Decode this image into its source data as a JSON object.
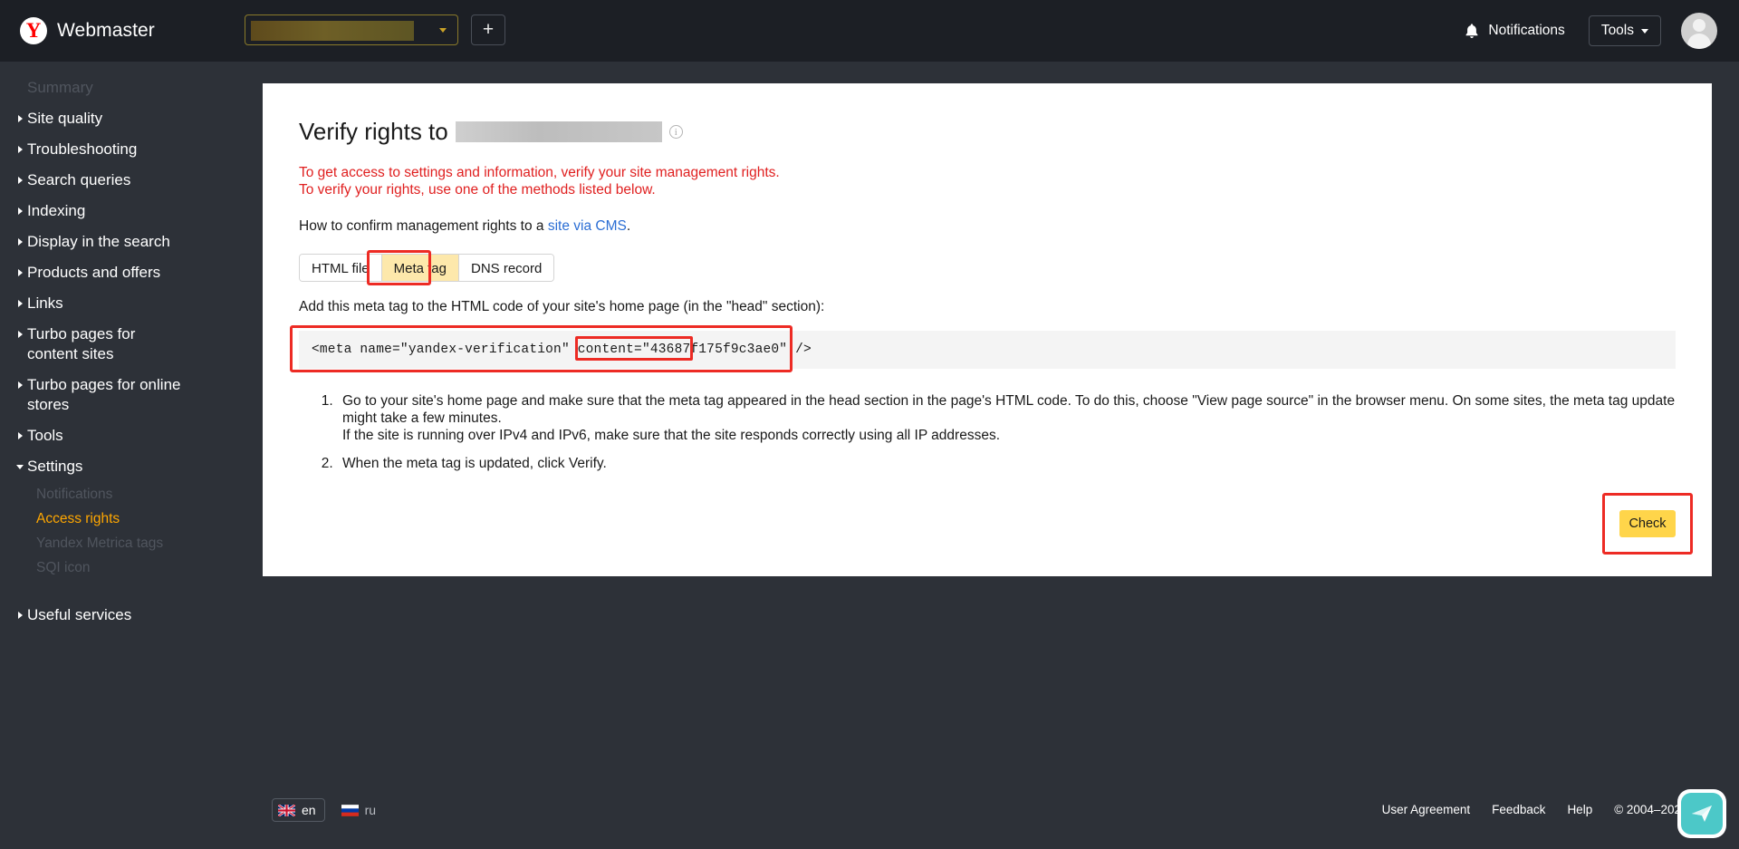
{
  "topbar": {
    "logo_letter": "Y",
    "brand": "Webmaster",
    "site_selector_value": "",
    "add_site_label": "+",
    "notifications_label": "Notifications",
    "tools_label": "Tools"
  },
  "sidebar": {
    "summary_label": "Summary",
    "items": [
      {
        "label": "Site quality",
        "state": "collapsed"
      },
      {
        "label": "Troubleshooting",
        "state": "collapsed"
      },
      {
        "label": "Search queries",
        "state": "collapsed"
      },
      {
        "label": "Indexing",
        "state": "collapsed"
      },
      {
        "label": "Display in the search",
        "state": "collapsed"
      },
      {
        "label": "Products and offers",
        "state": "collapsed"
      },
      {
        "label": "Links",
        "state": "collapsed"
      },
      {
        "label": "Turbo pages for content sites",
        "state": "collapsed"
      },
      {
        "label": "Turbo pages for online stores",
        "state": "collapsed"
      },
      {
        "label": "Tools",
        "state": "collapsed"
      },
      {
        "label": "Settings",
        "state": "expanded"
      }
    ],
    "settings_subitems": [
      {
        "label": "Notifications",
        "active": false
      },
      {
        "label": "Access rights",
        "active": true
      },
      {
        "label": "Yandex Metrica tags",
        "active": false
      },
      {
        "label": "SQI icon",
        "active": false
      }
    ],
    "useful_services_label": "Useful services"
  },
  "main": {
    "title": "Verify rights to",
    "site_name_redacted": "",
    "warning_line1": "To get access to settings and information, verify your site management rights.",
    "warning_line2": "To verify your rights, use one of the methods listed below.",
    "howto_prefix": "How to confirm management rights to a ",
    "howto_link": "site via CMS",
    "howto_suffix": ".",
    "tabs": [
      {
        "label": "HTML file",
        "selected": false
      },
      {
        "label": "Meta tag",
        "selected": true
      },
      {
        "label": "DNS record",
        "selected": false
      }
    ],
    "instruction_intro": "Add this meta tag to the HTML code of your site's home page (in the \"head\" section):",
    "code_prefix": "<meta name=\"yandex-verification\" content=\"",
    "code_value": "43687f175f9c3ae0",
    "code_suffix": "\" />",
    "steps": [
      {
        "text": "Go to your site's home page and make sure that the meta tag appeared in the head section in the page's HTML code. To do this, choose \"View page source\" in the browser menu. On some sites, the meta tag update might take a few minutes.",
        "sub": "If the site is running over IPv4 and IPv6, make sure that the site responds correctly using all IP addresses."
      },
      {
        "text": "When the meta tag is updated, click Verify.",
        "sub": ""
      }
    ],
    "check_button_label": "Check"
  },
  "footer": {
    "languages": [
      {
        "code": "en",
        "selected": true
      },
      {
        "code": "ru",
        "selected": false
      }
    ],
    "links": [
      "User Agreement",
      "Feedback",
      "Help"
    ],
    "copyright": "© 2004–2022 Yan"
  },
  "colors": {
    "accent_orange": "#ffa700",
    "annotation_red": "#ed2b24",
    "highlight_yellow": "#fde8ab",
    "button_yellow": "#ffd54a",
    "warning_red": "#e02020",
    "link_blue": "#2b6ed4"
  }
}
